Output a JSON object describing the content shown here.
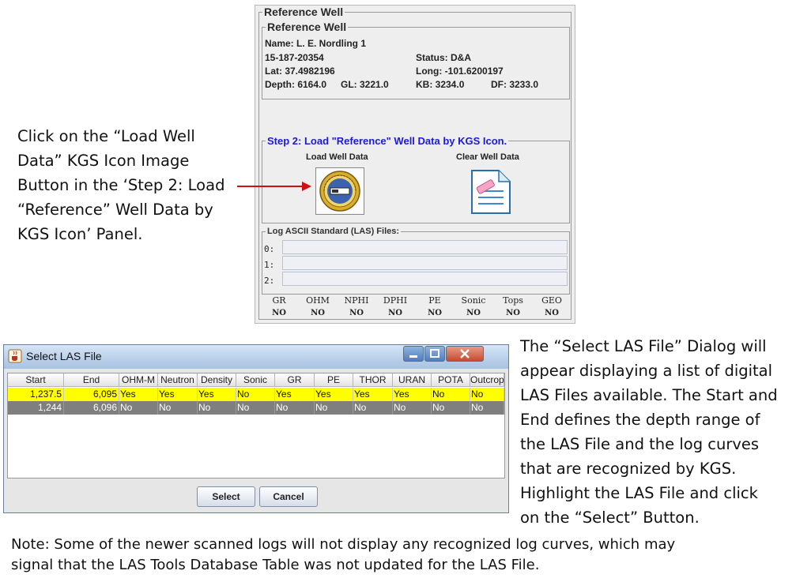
{
  "reference_panel": {
    "outer_title": "Reference Well",
    "inner_title": "Reference Well",
    "name": "Name: L. E. Nordling 1",
    "api": "15-187-20354",
    "status": "Status: D&A",
    "lat": "Lat: 37.4982196",
    "long": "Long: -101.6200197",
    "depth": "Depth: 6164.0",
    "gl": "GL: 3221.0",
    "kb": "KB: 3234.0",
    "df": "DF: 3233.0",
    "step2_title": "Step 2: Load \"Reference\" Well Data by KGS Icon.",
    "load_label": "Load Well Data",
    "clear_label": "Clear Well Data",
    "las_title": "Log ASCII Standard (LAS) Files:",
    "las_rows": [
      "0:",
      "1:",
      "2:"
    ],
    "curves": [
      {
        "label": "GR",
        "value": "NO"
      },
      {
        "label": "OHM",
        "value": "NO"
      },
      {
        "label": "NPHI",
        "value": "NO"
      },
      {
        "label": "DPHI",
        "value": "NO"
      },
      {
        "label": "PE",
        "value": "NO"
      },
      {
        "label": "Sonic",
        "value": "NO"
      },
      {
        "label": "Tops",
        "value": "NO"
      },
      {
        "label": "GEO",
        "value": "NO"
      }
    ],
    "colors": {
      "step2_title": "#1a1ad8",
      "arrow": "#d01010"
    }
  },
  "instruction_left": [
    "Click on the “Load Well",
    "Data” KGS Icon Image",
    "Button in the ‘Step 2: Load",
    "“Reference” Well Data by",
    "KGS Icon’ Panel."
  ],
  "dialog": {
    "title": "Select LAS File",
    "columns": [
      "Start",
      "End",
      "OHM-M",
      "Neutron",
      "Density",
      "Sonic",
      "GR",
      "PE",
      "THOR",
      "URAN",
      "POTA",
      "Outcrop"
    ],
    "rows": [
      [
        "1,237.5",
        "6,095",
        "Yes",
        "Yes",
        "Yes",
        "No",
        "Yes",
        "Yes",
        "Yes",
        "Yes",
        "No",
        "No"
      ],
      [
        "1,244",
        "6,096",
        "No",
        "No",
        "No",
        "No",
        "No",
        "No",
        "No",
        "No",
        "No",
        "No"
      ]
    ],
    "select_label": "Select",
    "cancel_label": "Cancel",
    "colors": {
      "selected_row": "#ffff00",
      "other_row": "#7f7f7f"
    }
  },
  "instruction_right": [
    "The “Select LAS File” Dialog will",
    "appear displaying a list of digital",
    "LAS Files available.  The Start and",
    "End defines the depth range of",
    "the LAS File and the log curves",
    "that are recognized by KGS.",
    "Highlight the LAS File and click",
    "on the “Select” Button."
  ],
  "note": [
    "Note: Some of the newer scanned logs will not display any recognized log curves, which may",
    "signal that the LAS Tools Database Table was not updated for the LAS File."
  ]
}
